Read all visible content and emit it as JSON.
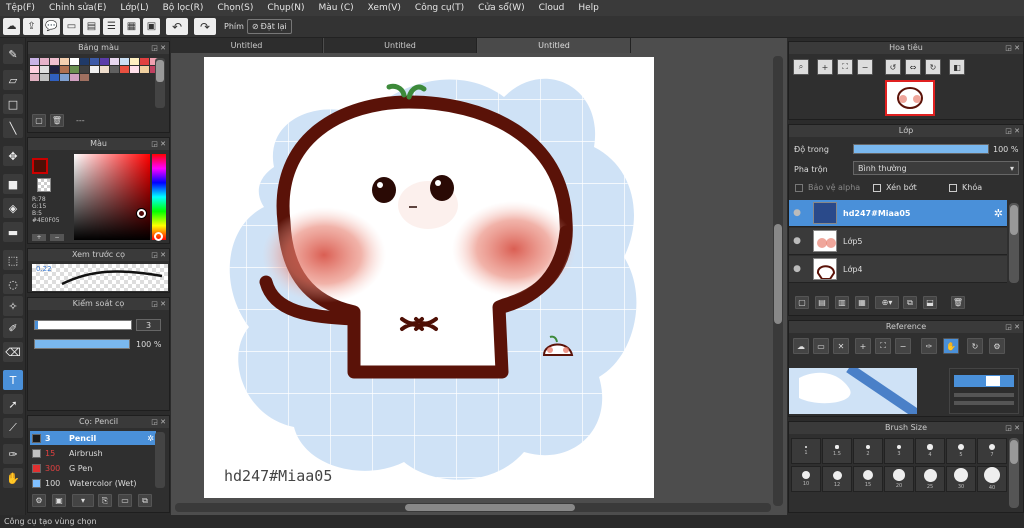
{
  "menu": [
    "Tệp(F)",
    "Chỉnh sửa(E)",
    "Lớp(L)",
    "Bộ lọc(R)",
    "Chọn(S)",
    "Chụp(N)",
    "Màu (C)",
    "Xem(V)",
    "Công cụ(T)",
    "Cửa sổ(W)",
    "Cloud",
    "Help"
  ],
  "toolbar": {
    "phim_label": "Phím",
    "reset_label": "Đặt lại"
  },
  "tabs": [
    "Untitled",
    "Untitled",
    "Untitled"
  ],
  "palette": {
    "title": "Bảng màu",
    "dash": "---",
    "colors": [
      "#c9b3e6",
      "#e6b3c9",
      "#f0c0d0",
      "#f5d0b0",
      "#ffffff",
      "#203a68",
      "#3c5aa8",
      "#5a3ca8",
      "#e8d8f0",
      "#cce0f5",
      "#fff0c0",
      "#e04040",
      "#f0a0b0",
      "#ffd0e0",
      "#e0e0e0",
      "#202040",
      "#b07050",
      "#6a9050",
      "#404040",
      "#f0f0f0",
      "#eeddcc",
      "#606060",
      "#e85040",
      "#ffe0ea",
      "#f0d0a0",
      "#c04060",
      "#e0b0c0",
      "#c0c0c0",
      "#3060c0",
      "#80a0d0",
      "#d0a0c0",
      "#a07060"
    ]
  },
  "color": {
    "title": "Màu",
    "r": "R:78",
    "g": "G:15",
    "b": "B:5",
    "hex": "#4E0F05",
    "fg": "#4e0f05"
  },
  "brush_preview": {
    "title": "Xem trước cọ",
    "size": "0.22"
  },
  "brush_control": {
    "title": "Kiểm soát cọ",
    "size": "3",
    "opacity_label": "100 %",
    "opacity": 1.0
  },
  "brush_list": {
    "title": "Cọ: Pencil",
    "items": [
      {
        "size": "3",
        "name": "Pencil",
        "color": "#1a1a1a"
      },
      {
        "size": "15",
        "name": "Airbrush",
        "color": "#c0c0c0"
      },
      {
        "size": "300",
        "name": "G Pen",
        "color": "#e03030"
      },
      {
        "size": "100",
        "name": "Watercolor (Wet)",
        "color": "#80c0ff"
      }
    ]
  },
  "canvas": {
    "signature": "hd247#Miaa05"
  },
  "navigator": {
    "title": "Hoa tiêu"
  },
  "layer": {
    "title": "Lớp",
    "opacity_label": "Độ trong",
    "opacity_value": "100 %",
    "opacity": 1.0,
    "blend_label": "Pha trộn",
    "blend_value": "Bình thường",
    "protect_alpha": "Bảo vệ alpha",
    "clipping": "Xén bớt",
    "lock": "Khóa",
    "rows": [
      {
        "name": "hd247#Miaa05"
      },
      {
        "name": "Lớp5"
      },
      {
        "name": "Lớp4"
      }
    ]
  },
  "reference": {
    "title": "Reference"
  },
  "brush_size": {
    "title": "Brush Size",
    "sizes": [
      "1",
      "1.5",
      "2",
      "3",
      "4",
      "5",
      "7",
      "10",
      "12",
      "15",
      "20",
      "25",
      "30",
      "40"
    ]
  },
  "status": "Công cụ tạo vùng chọn",
  "accent": "#4a90d9"
}
